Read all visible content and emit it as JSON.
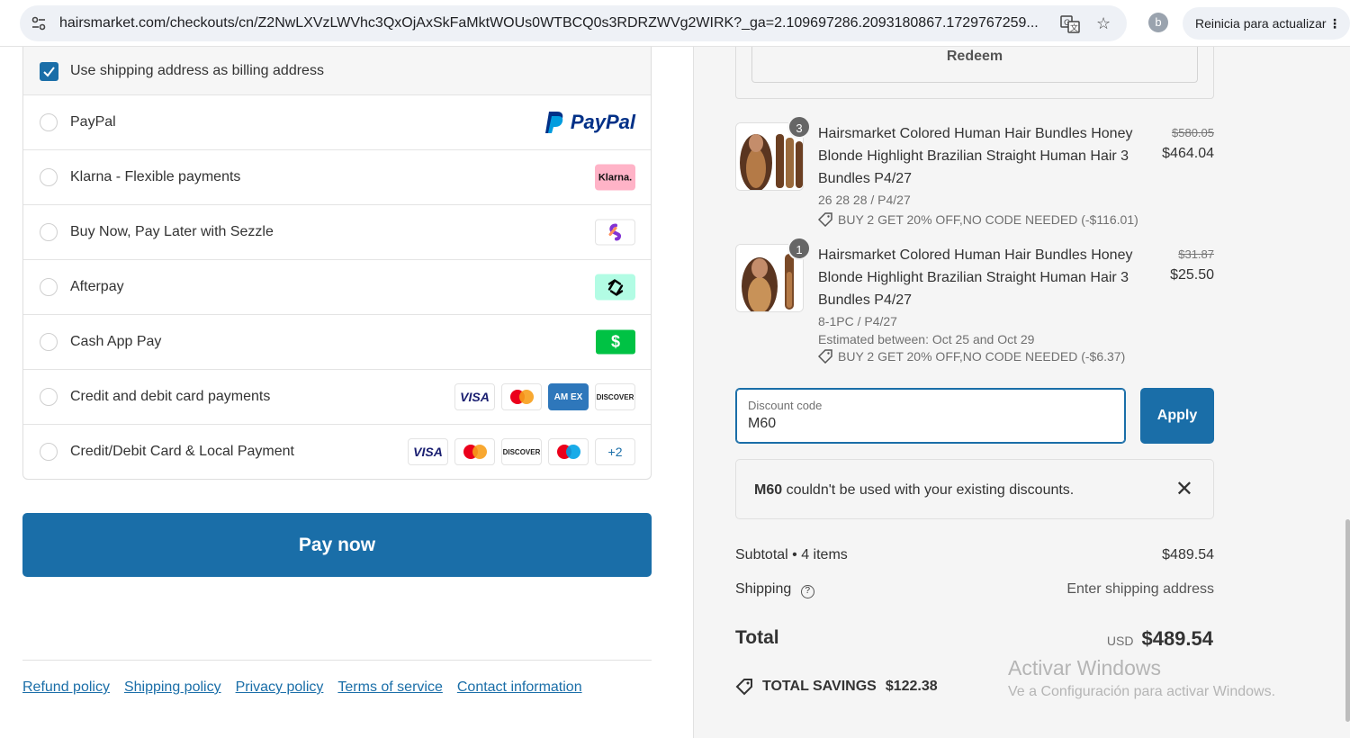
{
  "browser": {
    "url": "hairsmarket.com/checkouts/cn/Z2NwLXVzLWVhc3QxOjAxSkFaMktWOUs0WTBCQ0s3RDRZWVg2WIRK?_ga=2.109697286.2093180867.1729767259...",
    "profile_initial": "b",
    "update_button": "Reinicia para actualizar"
  },
  "payment": {
    "billing_label": "Use shipping address as billing address",
    "methods": [
      {
        "label": "PayPal"
      },
      {
        "label": "Klarna - Flexible payments"
      },
      {
        "label": "Buy Now, Pay Later with Sezzle"
      },
      {
        "label": "Afterpay"
      },
      {
        "label": "Cash App Pay"
      },
      {
        "label": "Credit and debit card payments"
      },
      {
        "label": "Credit/Debit Card & Local Payment"
      }
    ],
    "paypal_logo": "PayPal",
    "klarna_logo": "Klarna.",
    "cashapp_logo": "$",
    "visa": "VISA",
    "amex": "AM EX",
    "discover": "DISCOVER",
    "more_cards": "+2",
    "pay_now": "Pay now"
  },
  "footer": {
    "links": [
      "Refund policy",
      "Shipping policy",
      "Privacy policy",
      "Terms of service",
      "Contact information"
    ]
  },
  "summary": {
    "redeem": "Redeem",
    "items": [
      {
        "qty": "3",
        "title": "Hairsmarket Colored Human Hair Bundles Honey Blonde Highlight Brazilian Straight Human Hair 3 Bundles P4/27",
        "variant": "26 28 28 / P4/27",
        "old_price": "$580.05",
        "price": "$464.04",
        "discount": "BUY 2 GET 20% OFF,NO CODE NEEDED (-$116.01)"
      },
      {
        "qty": "1",
        "title": "Hairsmarket Colored Human Hair Bundles Honey Blonde Highlight Brazilian Straight Human Hair 3 Bundles P4/27",
        "variant": "8-1PC / P4/27",
        "estimate": "Estimated between: Oct 25 and Oct 29",
        "old_price": "$31.87",
        "price": "$25.50",
        "discount": "BUY 2 GET 20% OFF,NO CODE NEEDED (-$6.37)"
      }
    ],
    "discount_label": "Discount code",
    "discount_value": "M60",
    "apply": "Apply",
    "error_code": "M60",
    "error_text": " couldn't be used with your existing discounts.",
    "subtotal_label": "Subtotal • 4 items",
    "subtotal_value": "$489.54",
    "shipping_label": "Shipping",
    "shipping_value": "Enter shipping address",
    "total_label": "Total",
    "currency": "USD",
    "total_value": "$489.54",
    "savings_label": "TOTAL SAVINGS",
    "savings_value": "$122.38"
  },
  "watermark": {
    "line1": "Activar Windows",
    "line2": "Ve a Configuración para activar Windows."
  },
  "colors": {
    "accent": "#1a6ea8",
    "klarna": "#ffb3c7",
    "afterpay": "#b2fce4",
    "cashapp": "#00c244"
  }
}
